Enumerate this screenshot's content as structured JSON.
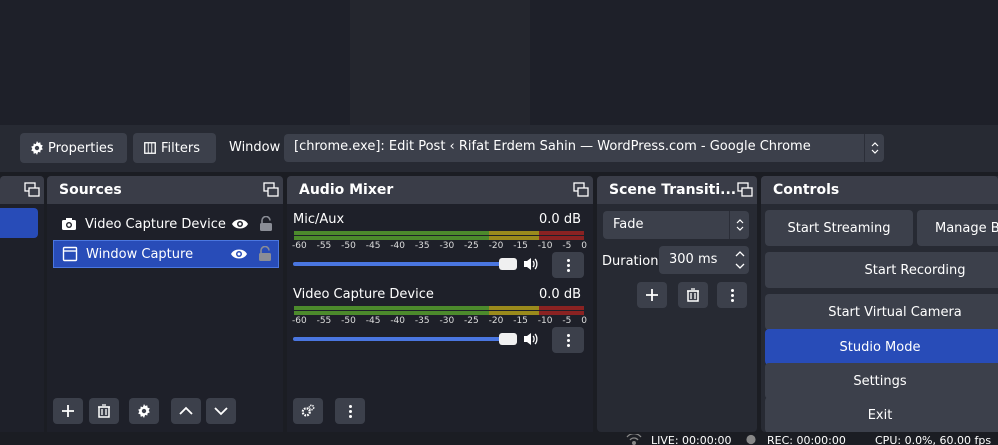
{
  "context_bar": {
    "properties_label": "Properties",
    "filters_label": "Filters",
    "window_label": "Window",
    "window_value": "[chrome.exe]: Edit Post ‹ Rifat Erdem Sahin — WordPress.com - Google Chrome"
  },
  "sources": {
    "title": "Sources",
    "items": [
      {
        "label": "Video Capture Device",
        "icon": "camera-icon",
        "selected": false
      },
      {
        "label": "Window Capture",
        "icon": "window-icon",
        "selected": true
      }
    ]
  },
  "audio_mixer": {
    "title": "Audio Mixer",
    "channels": [
      {
        "name": "Mic/Aux",
        "db": "0.0 dB",
        "volume": 1.0
      },
      {
        "name": "Video Capture Device",
        "db": "0.0 dB",
        "volume": 1.0
      }
    ],
    "scale": [
      "-60",
      "-55",
      "-50",
      "-45",
      "-40",
      "-35",
      "-30",
      "-25",
      "-20",
      "-15",
      "-10",
      "-5",
      "0"
    ]
  },
  "transitions": {
    "title": "Scene Transiti...",
    "transition": "Fade",
    "duration_label": "Duration",
    "duration_value": "300 ms"
  },
  "controls": {
    "title": "Controls",
    "start_streaming": "Start Streaming",
    "manage_broadcast": "Manage Br",
    "start_recording": "Start Recording",
    "start_virtual_camera": "Start Virtual Camera",
    "studio_mode": "Studio Mode",
    "settings": "Settings",
    "exit": "Exit"
  },
  "status": {
    "live": "LIVE: 00:00:00",
    "rec": "REC: 00:00:00",
    "cpu": "CPU: 0.0%, 60.00 fps"
  },
  "colors": {
    "accent": "#284cb8",
    "meter_green": "#4c8a2c",
    "meter_yellow": "#9a8a1c",
    "meter_red": "#8a2222"
  }
}
